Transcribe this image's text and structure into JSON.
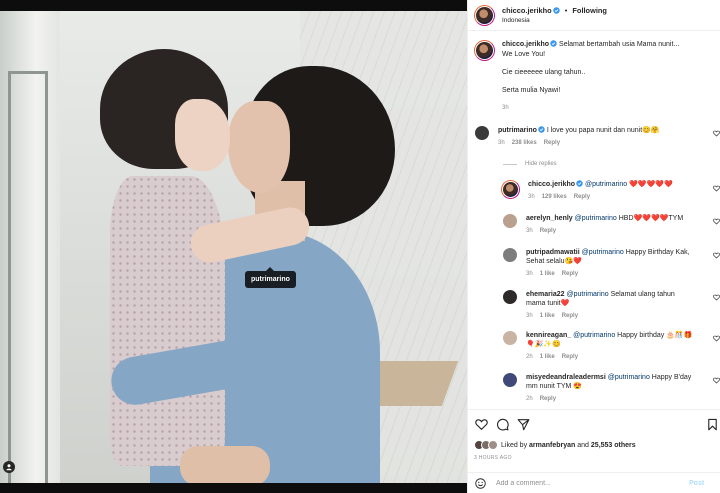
{
  "post": {
    "author": "chicco.jerikho",
    "follow_status": "Following",
    "location": "Indonesia",
    "tag_popup": "putrimarino"
  },
  "caption": {
    "username": "chicco.jerikho",
    "line1": "Selamat bertambah usia Mama nunit...",
    "line2": "We Love You!",
    "line3": "Cie cieeeeee ulang tahun..",
    "line4": "Serta mulia Nyawi!",
    "time": "3h"
  },
  "comments": [
    {
      "username": "putrimarino",
      "text": "I love you papa nunit dan nunit😊🤗",
      "time": "3h",
      "likes": "238 likes",
      "reply": "Reply"
    },
    {
      "username": "chicco.jerikho",
      "mention": "@putrimarino",
      "text": "❤️❤️❤️❤️❤️",
      "time": "3h",
      "likes": "129 likes",
      "reply": "Reply"
    },
    {
      "username": "aerelyn_henly",
      "mention": "@putrimarino",
      "text": "HBD❤️❤️❤️❤️TYM",
      "time": "3h",
      "reply": "Reply"
    },
    {
      "username": "putripadmawatii",
      "mention": "@putrimarino",
      "text": "Happy Birthday Kak,",
      "text2": "Sehat selalu😘❤️",
      "time": "3h",
      "likes": "1 like",
      "reply": "Reply"
    },
    {
      "username": "ehemaria22",
      "mention": "@putrimarino",
      "text": "Selamat ulang tahun",
      "text2": "mama tunit❤️",
      "time": "3h",
      "likes": "1 like",
      "reply": "Reply"
    },
    {
      "username": "kennireagan_",
      "mention": "@putrimarino",
      "text": "Happy birthday 🎂🎊🎁",
      "text2": "🎈🎉✨😊",
      "time": "2h",
      "likes": "1 like",
      "reply": "Reply"
    },
    {
      "username": "misyedeandraleadermsi",
      "mention": "@putrimarino",
      "text": "Happy B'day",
      "text2": "mm nunit TYM 😍",
      "time": "2h",
      "reply": "Reply"
    }
  ],
  "hide_replies": "Hide replies",
  "likes": {
    "prefix": "Liked by ",
    "user": "armanfebryan",
    "middle": " and ",
    "count": "25,553 others"
  },
  "post_time": "3 HOURS AGO",
  "add_comment": {
    "placeholder": "Add a comment...",
    "post_label": "Post"
  },
  "colors": {
    "link": "#00376b",
    "muted": "#8e8e8e",
    "verified": "#3897f0",
    "like_heart": "#262626"
  }
}
